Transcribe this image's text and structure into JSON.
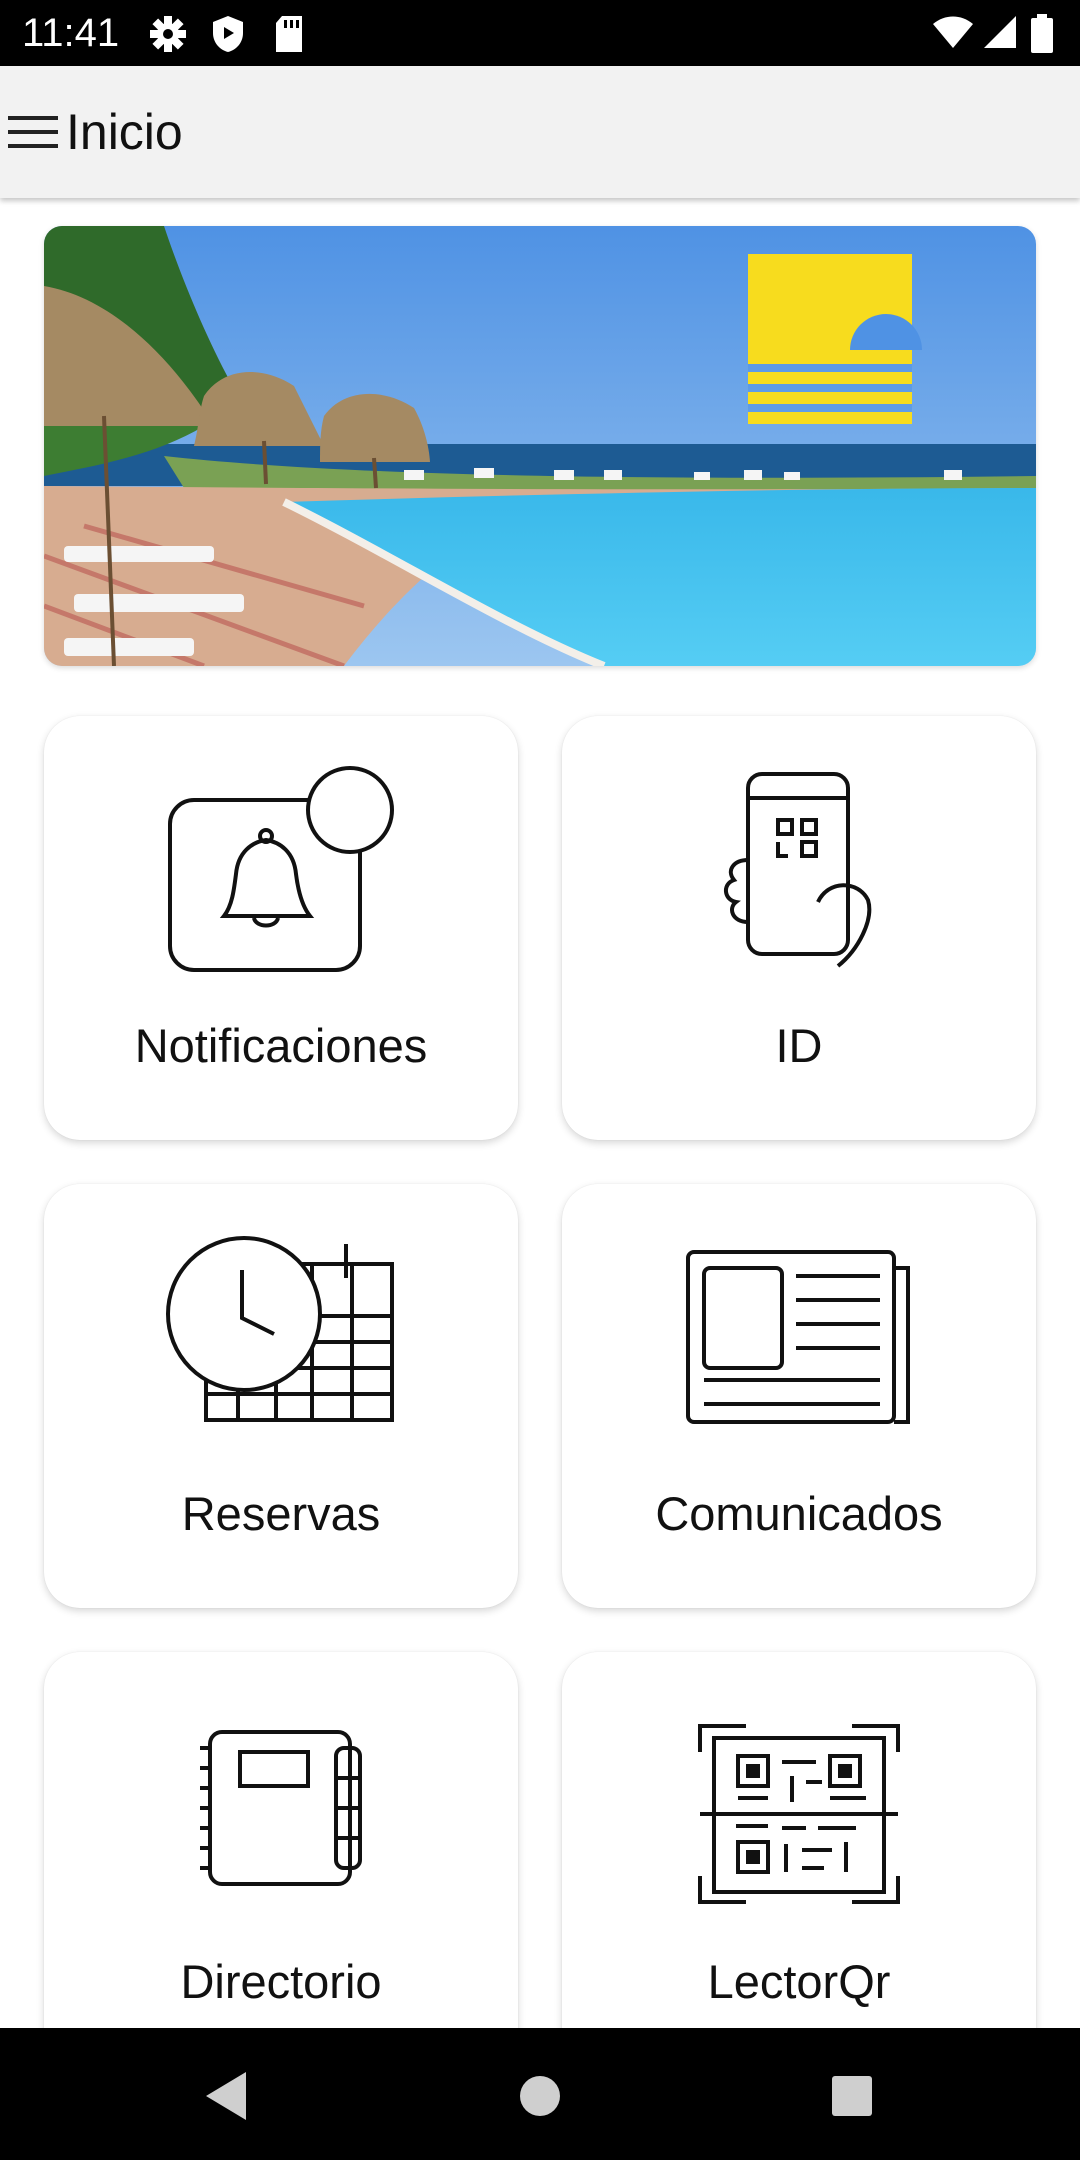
{
  "status_bar": {
    "time": "11:41",
    "icons_left": [
      "gear-icon",
      "shield-icon",
      "sd-card-icon"
    ],
    "icons_right": [
      "wifi-icon",
      "signal-icon",
      "battery-icon"
    ]
  },
  "app_bar": {
    "title": "Inicio",
    "menu_icon": "hamburger-menu-icon"
  },
  "banner": {
    "description_icon": "resort-logo-icon",
    "logo_color": "#f7dc1e"
  },
  "tiles": [
    {
      "label": "Notificaciones",
      "icon": "notification-bell-icon"
    },
    {
      "label": "ID",
      "icon": "phone-qr-id-icon"
    },
    {
      "label": "Reservas",
      "icon": "clock-calendar-icon"
    },
    {
      "label": "Comunicados",
      "icon": "newspaper-icon"
    },
    {
      "label": "Directorio",
      "icon": "notebook-icon"
    },
    {
      "label": "LectorQr",
      "icon": "qr-scanner-icon"
    }
  ],
  "nav_bar": {
    "buttons": [
      "back-icon",
      "home-icon",
      "recents-icon"
    ]
  },
  "colors": {
    "status_bar": "#000000",
    "app_bar": "#f2f2f2",
    "card_bg": "#ffffff",
    "nav_bar": "#000000"
  }
}
